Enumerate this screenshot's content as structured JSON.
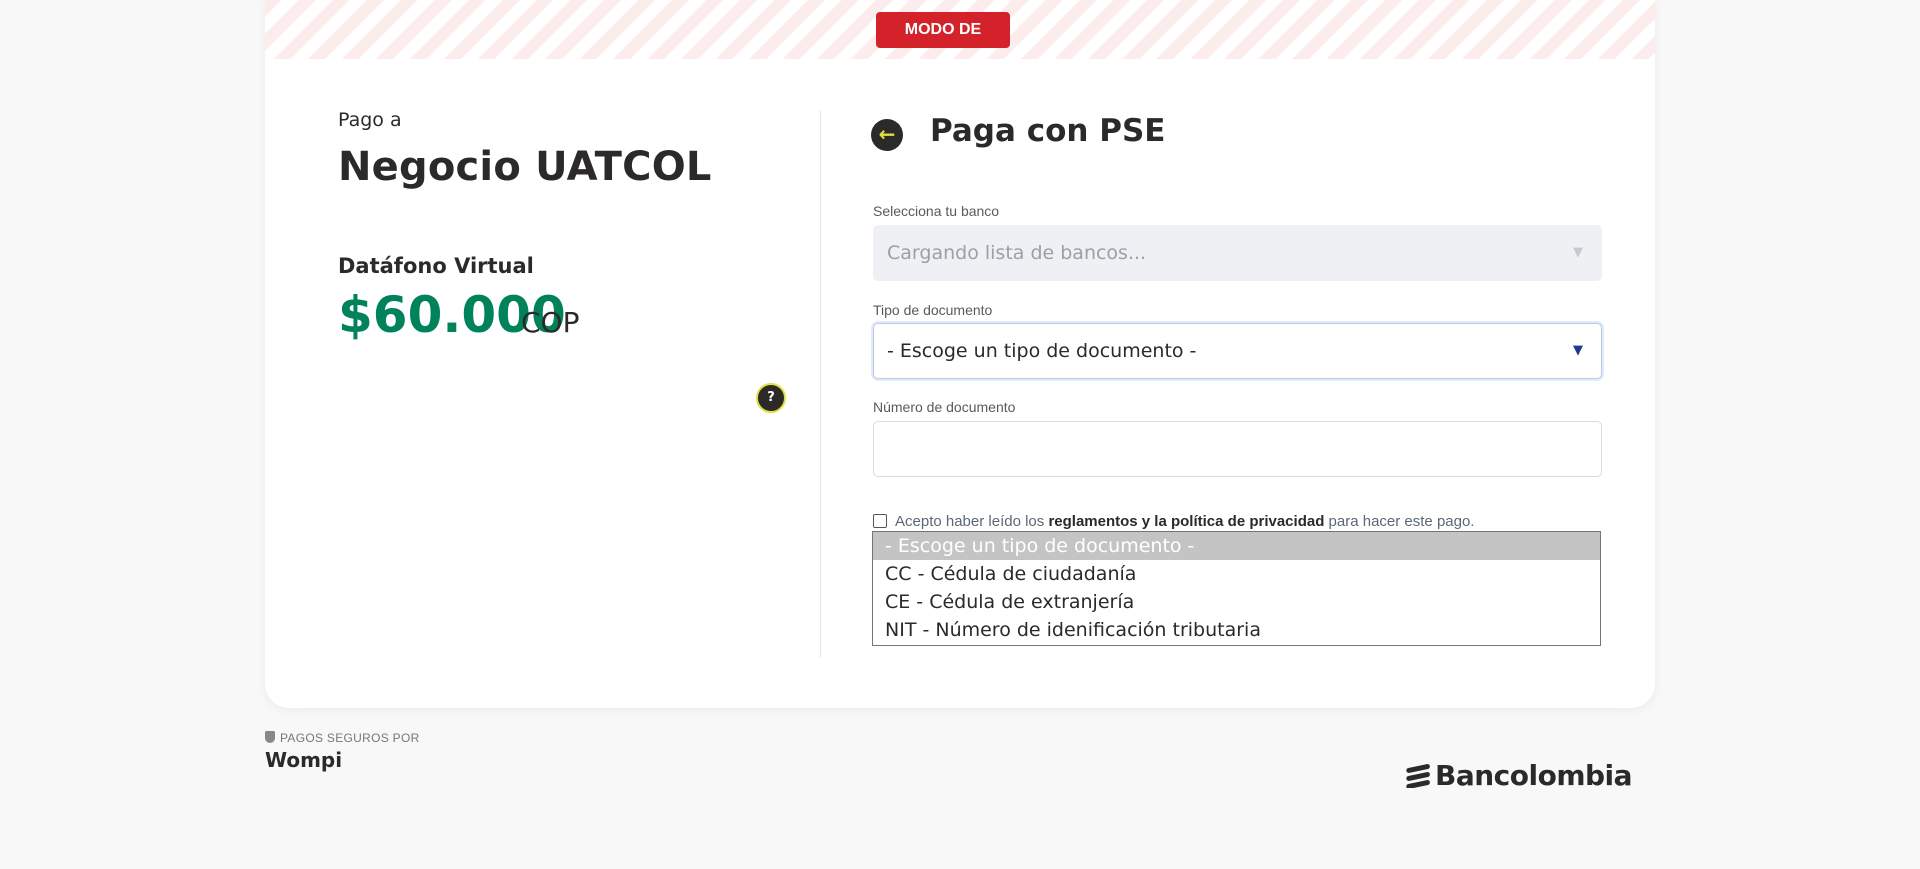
{
  "banner": {
    "badge": "MODO DE PRUEBAS"
  },
  "merchant": {
    "pay_to_label": "Pago a",
    "name": "Negocio UATCOL",
    "product": "Datáfono Virtual",
    "amount": "$60.000",
    "currency": "COP",
    "help_icon": "?"
  },
  "payment": {
    "back_icon": "←",
    "title": "Paga con PSE",
    "bank": {
      "label": "Selecciona tu banco",
      "value": "Cargando lista de bancos..."
    },
    "doc_type": {
      "label": "Tipo de documento",
      "value": "- Escoge un tipo de documento -",
      "options": [
        "- Escoge un tipo de documento -",
        "CC - Cédula de ciudadanía",
        "CE - Cédula de extranjería",
        "NIT - Número de idenificación tributaria"
      ]
    },
    "doc_number": {
      "label": "Número de documento",
      "value": ""
    },
    "terms": {
      "prefix": "Acepto haber leído los ",
      "bold": "reglamentos y la política de privacidad",
      "suffix": " para hacer este pago."
    }
  },
  "footer": {
    "secure_label": "PAGOS SEGUROS POR",
    "wompi": "Wompi",
    "bank_brand": "Bancolombia"
  },
  "colors": {
    "badge": "#d3222a",
    "amount": "#00825a",
    "accent": "#dfe03f"
  }
}
